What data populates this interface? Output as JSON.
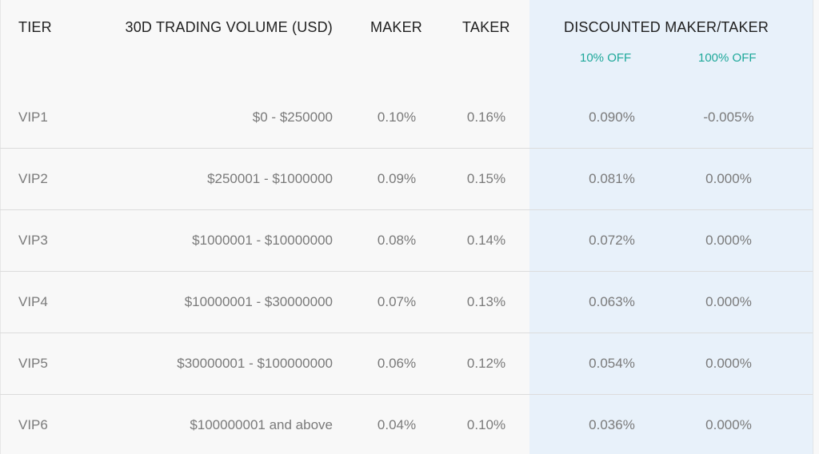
{
  "table": {
    "headers": {
      "tier": "TIER",
      "volume": "30D TRADING VOLUME (USD)",
      "maker": "MAKER",
      "taker": "TAKER",
      "discounted": "DISCOUNTED MAKER/TAKER"
    },
    "discount_labels": {
      "maker": "10% OFF",
      "taker": "100% OFF"
    },
    "accent_color": "#1ea89a",
    "highlight_color": "#e8f1fa",
    "rows": [
      {
        "tier": "VIP1",
        "volume": "$0 - $250000",
        "maker": "0.10%",
        "taker": "0.16%",
        "disc_maker": "0.090%",
        "disc_taker": "-0.005%"
      },
      {
        "tier": "VIP2",
        "volume": "$250001 - $1000000",
        "maker": "0.09%",
        "taker": "0.15%",
        "disc_maker": "0.081%",
        "disc_taker": "0.000%"
      },
      {
        "tier": "VIP3",
        "volume": "$1000001 - $10000000",
        "maker": "0.08%",
        "taker": "0.14%",
        "disc_maker": "0.072%",
        "disc_taker": "0.000%"
      },
      {
        "tier": "VIP4",
        "volume": "$10000001 - $30000000",
        "maker": "0.07%",
        "taker": "0.13%",
        "disc_maker": "0.063%",
        "disc_taker": "0.000%"
      },
      {
        "tier": "VIP5",
        "volume": "$30000001 - $100000000",
        "maker": "0.06%",
        "taker": "0.12%",
        "disc_maker": "0.054%",
        "disc_taker": "0.000%"
      },
      {
        "tier": "VIP6",
        "volume": "$100000001 and above",
        "maker": "0.04%",
        "taker": "0.10%",
        "disc_maker": "0.036%",
        "disc_taker": "0.000%"
      }
    ]
  }
}
